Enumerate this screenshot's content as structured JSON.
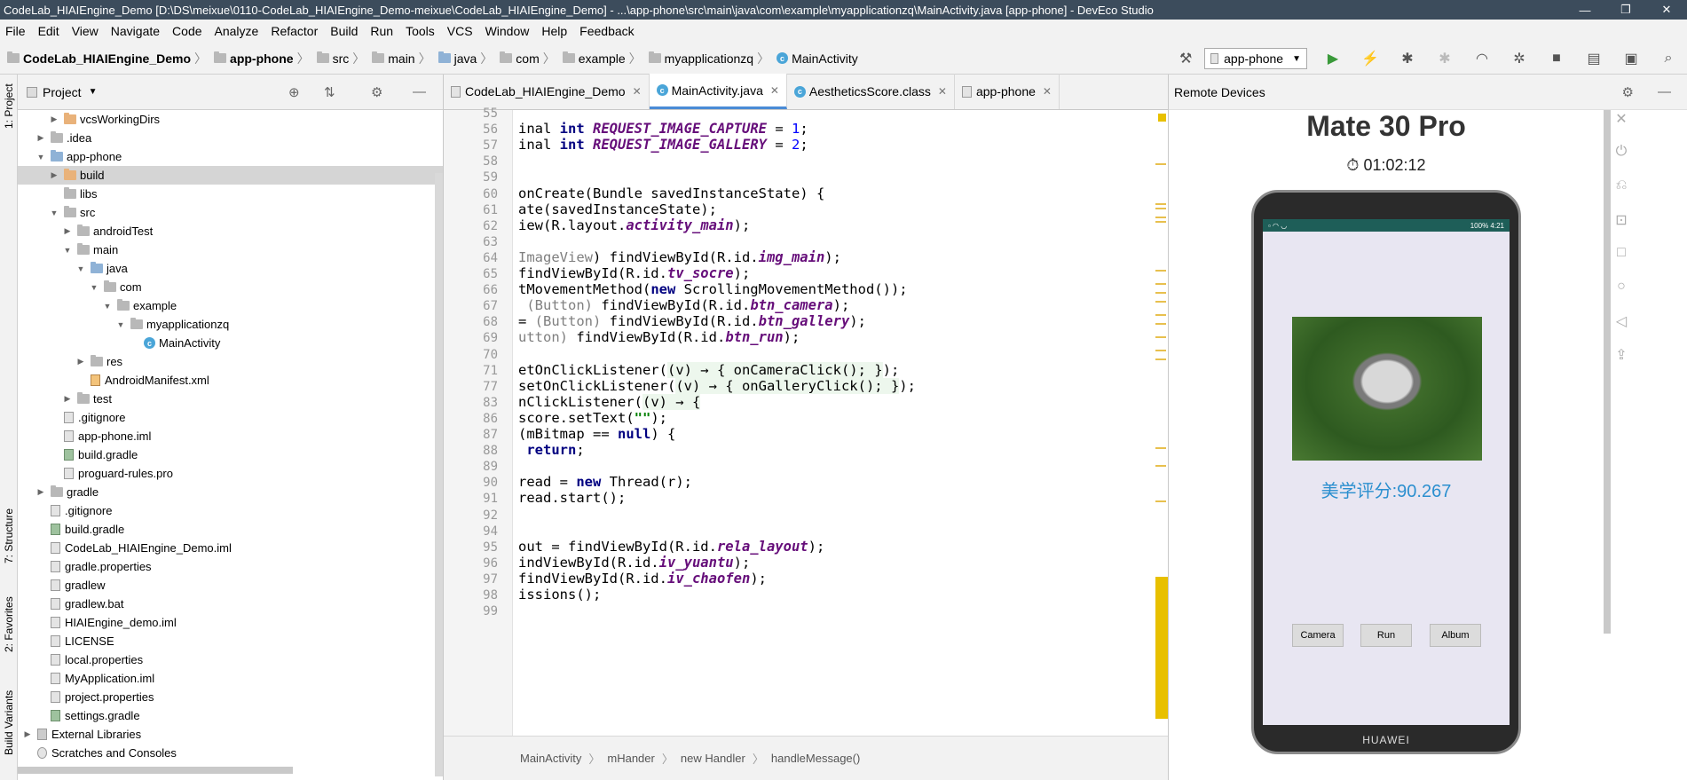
{
  "window": {
    "title": "CodeLab_HIAIEngine_Demo [D:\\DS\\meixue\\0110-CodeLab_HIAIEngine_Demo-meixue\\CodeLab_HIAIEngine_Demo] - ...\\app-phone\\src\\main\\java\\com\\example\\myapplicationzq\\MainActivity.java [app-phone] - DevEco Studio",
    "minimize": "—",
    "maximize": "❐",
    "close": "✕"
  },
  "menu": [
    "File",
    "Edit",
    "View",
    "Navigate",
    "Code",
    "Analyze",
    "Refactor",
    "Build",
    "Run",
    "Tools",
    "VCS",
    "Window",
    "Help",
    "Feedback"
  ],
  "nav": {
    "crumbs": [
      "CodeLab_HIAIEngine_Demo",
      "app-phone",
      "src",
      "main",
      "java",
      "com",
      "example",
      "myapplicationzq",
      "MainActivity"
    ],
    "run_config": "app-phone"
  },
  "left_strip": {
    "project": "1: Project",
    "structure": "7: Structure",
    "favorites": "2: Favorites",
    "build_variants": "Build Variants"
  },
  "project_panel": {
    "title": "Project",
    "tree": [
      {
        "label": "vcsWorkingDirs",
        "indent": 2,
        "type": "folder-o",
        "arrow": "▶",
        "sel": false
      },
      {
        "label": ".idea",
        "indent": 1,
        "type": "folder",
        "arrow": "▶",
        "sel": false
      },
      {
        "label": "app-phone",
        "indent": 1,
        "type": "folder-b",
        "arrow": "▼",
        "sel": false
      },
      {
        "label": "build",
        "indent": 2,
        "type": "folder-o",
        "arrow": "▶",
        "sel": true
      },
      {
        "label": "libs",
        "indent": 2,
        "type": "folder",
        "arrow": "",
        "sel": false
      },
      {
        "label": "src",
        "indent": 2,
        "type": "folder",
        "arrow": "▼",
        "sel": false
      },
      {
        "label": "androidTest",
        "indent": 3,
        "type": "folder",
        "arrow": "▶",
        "sel": false
      },
      {
        "label": "main",
        "indent": 3,
        "type": "folder",
        "arrow": "▼",
        "sel": false
      },
      {
        "label": "java",
        "indent": 4,
        "type": "folder-b",
        "arrow": "▼",
        "sel": false
      },
      {
        "label": "com",
        "indent": 5,
        "type": "folder",
        "arrow": "▼",
        "sel": false
      },
      {
        "label": "example",
        "indent": 6,
        "type": "folder",
        "arrow": "▼",
        "sel": false
      },
      {
        "label": "myapplicationzq",
        "indent": 7,
        "type": "folder",
        "arrow": "▼",
        "sel": false
      },
      {
        "label": "MainActivity",
        "indent": 8,
        "type": "class",
        "arrow": "",
        "sel": false
      },
      {
        "label": "res",
        "indent": 4,
        "type": "folder",
        "arrow": "▶",
        "sel": false
      },
      {
        "label": "AndroidManifest.xml",
        "indent": 4,
        "type": "file-x",
        "arrow": "",
        "sel": false
      },
      {
        "label": "test",
        "indent": 3,
        "type": "folder",
        "arrow": "▶",
        "sel": false
      },
      {
        "label": ".gitignore",
        "indent": 2,
        "type": "file",
        "arrow": "",
        "sel": false
      },
      {
        "label": "app-phone.iml",
        "indent": 2,
        "type": "file",
        "arrow": "",
        "sel": false
      },
      {
        "label": "build.gradle",
        "indent": 2,
        "type": "file-g",
        "arrow": "",
        "sel": false
      },
      {
        "label": "proguard-rules.pro",
        "indent": 2,
        "type": "file",
        "arrow": "",
        "sel": false
      },
      {
        "label": "gradle",
        "indent": 1,
        "type": "folder",
        "arrow": "▶",
        "sel": false
      },
      {
        "label": ".gitignore",
        "indent": 1,
        "type": "file",
        "arrow": "",
        "sel": false
      },
      {
        "label": "build.gradle",
        "indent": 1,
        "type": "file-g",
        "arrow": "",
        "sel": false
      },
      {
        "label": "CodeLab_HIAIEngine_Demo.iml",
        "indent": 1,
        "type": "file",
        "arrow": "",
        "sel": false
      },
      {
        "label": "gradle.properties",
        "indent": 1,
        "type": "file",
        "arrow": "",
        "sel": false
      },
      {
        "label": "gradlew",
        "indent": 1,
        "type": "file",
        "arrow": "",
        "sel": false
      },
      {
        "label": "gradlew.bat",
        "indent": 1,
        "type": "file",
        "arrow": "",
        "sel": false
      },
      {
        "label": "HIAIEngine_demo.iml",
        "indent": 1,
        "type": "file",
        "arrow": "",
        "sel": false
      },
      {
        "label": "LICENSE",
        "indent": 1,
        "type": "file",
        "arrow": "",
        "sel": false
      },
      {
        "label": "local.properties",
        "indent": 1,
        "type": "file",
        "arrow": "",
        "sel": false
      },
      {
        "label": "MyApplication.iml",
        "indent": 1,
        "type": "file",
        "arrow": "",
        "sel": false
      },
      {
        "label": "project.properties",
        "indent": 1,
        "type": "file",
        "arrow": "",
        "sel": false
      },
      {
        "label": "settings.gradle",
        "indent": 1,
        "type": "file-g",
        "arrow": "",
        "sel": false
      },
      {
        "label": "External Libraries",
        "indent": 0,
        "type": "lib",
        "arrow": "▶",
        "sel": false
      },
      {
        "label": "Scratches and Consoles",
        "indent": 0,
        "type": "scratch",
        "arrow": "",
        "sel": false
      }
    ]
  },
  "editor": {
    "tabs": [
      {
        "label": "CodeLab_HIAIEngine_Demo",
        "active": false
      },
      {
        "label": "MainActivity.java",
        "active": true
      },
      {
        "label": "AestheticsScore.class",
        "active": false
      },
      {
        "label": "app-phone",
        "active": false
      }
    ],
    "line_numbers": [
      "55",
      "56",
      "57",
      "58",
      "59",
      "60",
      "61",
      "62",
      "63",
      "64",
      "65",
      "66",
      "67",
      "68",
      "69",
      "70",
      "71",
      "77",
      "83",
      "86",
      "87",
      "88",
      "89",
      "90",
      "91",
      "92",
      "94",
      "95",
      "96",
      "97",
      "98",
      "99"
    ],
    "code_lines": [
      "",
      "inal int @REQUEST_IMAGE_CAPTURE@ = #1#;",
      "inal int @REQUEST_IMAGE_GALLERY@ = #2#;",
      "",
      "",
      "onCreate(Bundle savedInstanceState) {",
      "ate(savedInstanceState);",
      "iew(R.layout.@activity_main@);",
      "",
      "~ImageView~) findViewById(R.id.@img_main@);",
      "findViewById(R.id.@tv_socre@);",
      "tMovementMethod(!new! ScrollingMovementMethod());",
      " ~(Button)~ findViewById(R.id.@btn_camera@);",
      "= ~(Button)~ findViewById(R.id.@btn_gallery@);",
      "~utton)~ findViewById(R.id.@btn_run@);",
      "",
      "etOnClickListener(%(v) → { onCameraClick(); }%);",
      "setOnClickListener(%(v) → { onGalleryClick(); }%);",
      "nClickListener(%(v) → {%",
      "score.setText($\"\"$);",
      "(mBitmap == !null!) {",
      " !return!;",
      "",
      "read = !new! Thread(r);",
      "read.start();",
      "",
      "",
      "out = findViewById(R.id.@rela_layout@);",
      "indViewById(R.id.@iv_yuantu@);",
      "findViewById(R.id.@iv_chaofen@);",
      "issions();",
      ""
    ],
    "breadcrumb": [
      "MainActivity",
      "mHander",
      "new Handler",
      "handleMessage()"
    ]
  },
  "remote": {
    "title": "Remote Devices",
    "device": "Mate 30 Pro",
    "timer": "01:02:12",
    "status_right": "100% 4:21",
    "score": "美学评分:90.267",
    "buttons": [
      "Camera",
      "Run",
      "Album"
    ],
    "brand": "HUAWEI"
  }
}
